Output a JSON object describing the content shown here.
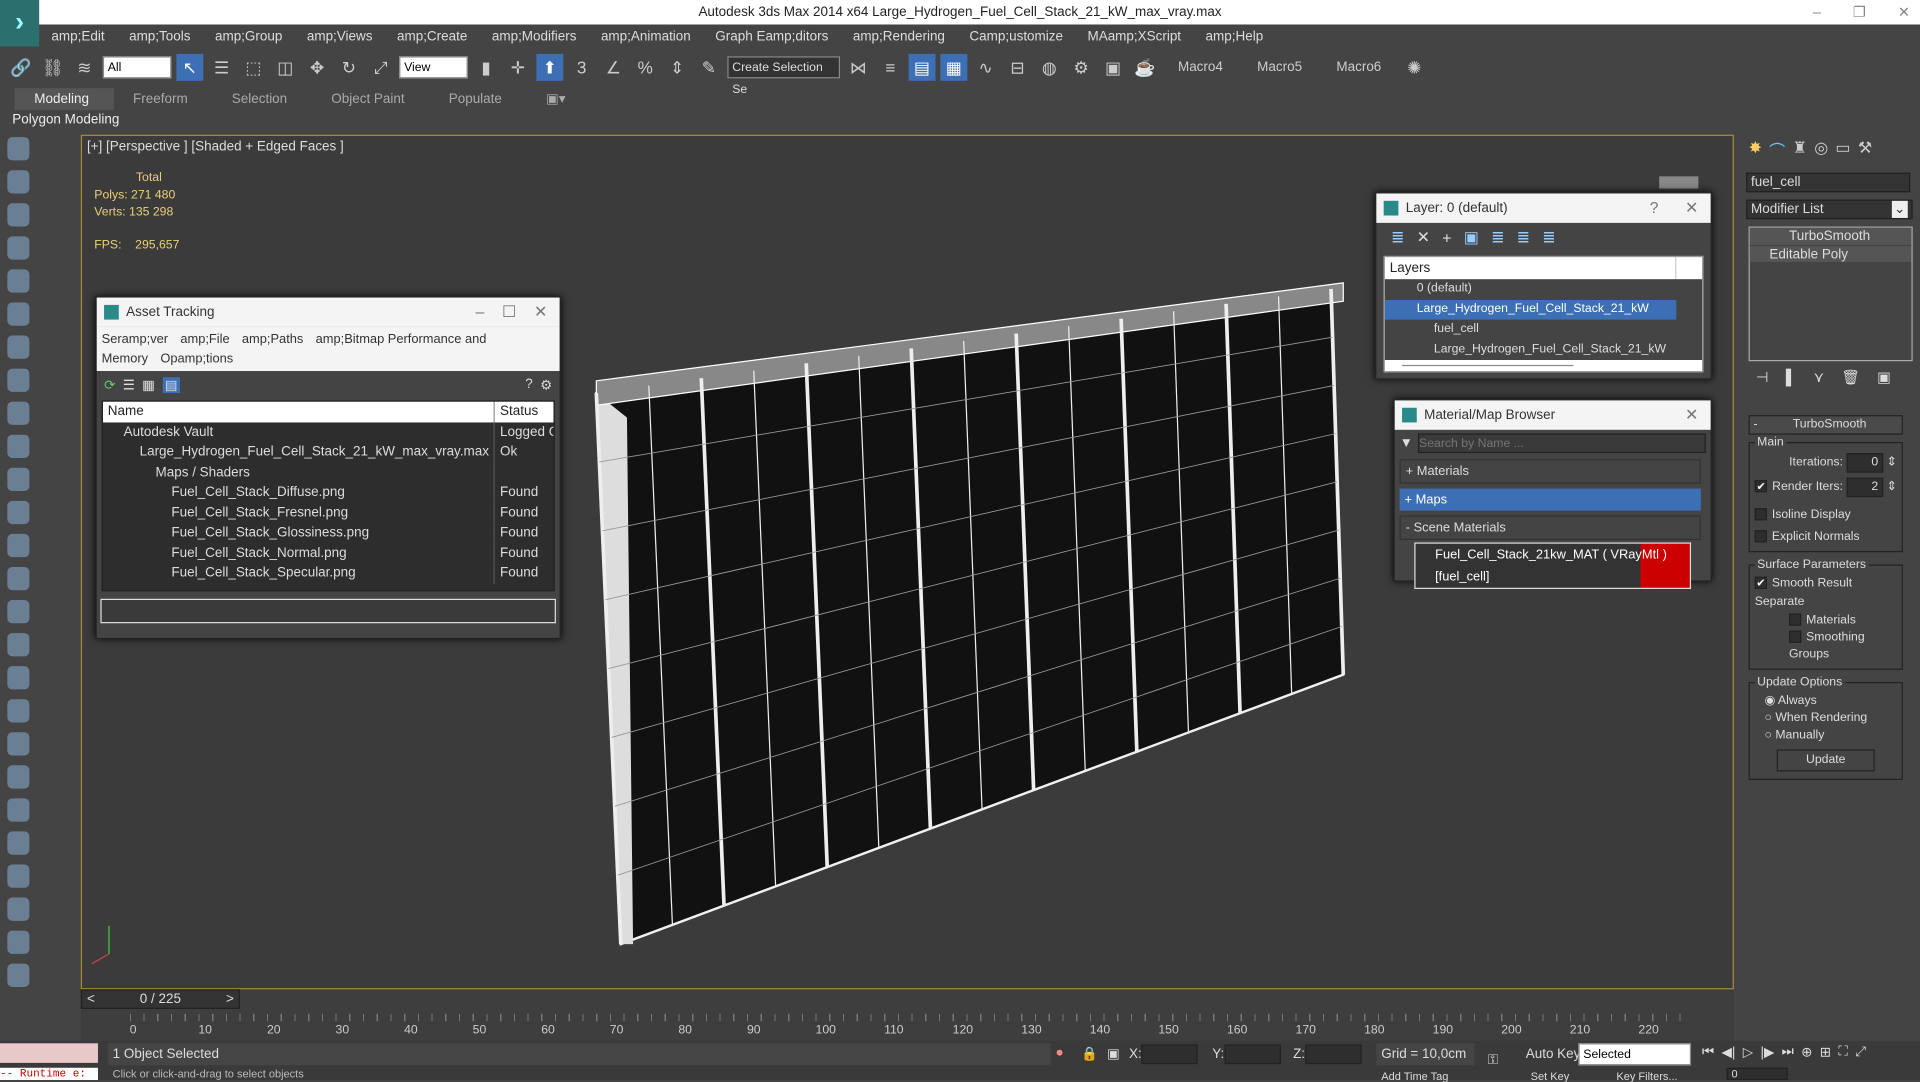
{
  "app": {
    "title": "Autodesk 3ds Max  2014 x64    Large_Hydrogen_Fuel_Cell_Stack_21_kW_max_vray.max",
    "window_controls": [
      "–",
      "❐",
      "✕"
    ]
  },
  "menu": [
    "amp;Edit",
    "amp;Tools",
    "amp;Group",
    "amp;Views",
    "amp;Create",
    "amp;Modifiers",
    "amp;Animation",
    "Graph Eamp;ditors",
    "amp;Rendering",
    "Camp;ustomize",
    "MAamp;XScript",
    "amp;Help"
  ],
  "toolbar": {
    "selection_filter": "All",
    "ref_coord": "View",
    "named_selection": "Create Selection Se",
    "macros": [
      "Macro4",
      "Macro5",
      "Macro6"
    ]
  },
  "ribbon": {
    "tabs": [
      "Modeling",
      "Freeform",
      "Selection",
      "Object Paint",
      "Populate"
    ],
    "active": "Modeling",
    "panel": "Polygon Modeling"
  },
  "viewport": {
    "label": "[+] [Perspective ] [Shaded + Edged Faces ]",
    "stats": {
      "total_label": "Total",
      "polys_label": "Polys:",
      "polys": "271 480",
      "verts_label": "Verts:",
      "verts": "135 298",
      "fps_label": "FPS:",
      "fps": "295,657"
    }
  },
  "asset_tracking": {
    "title": "Asset Tracking",
    "menu": [
      "Seramp;ver",
      "amp;File",
      "amp;Paths",
      "amp;Bitmap Performance and Memory",
      "Opamp;tions"
    ],
    "columns": [
      "Name",
      "Status"
    ],
    "rows": [
      {
        "name": "Autodesk Vault",
        "status": "Logged Ou",
        "indent": 1
      },
      {
        "name": "Large_Hydrogen_Fuel_Cell_Stack_21_kW_max_vray.max",
        "status": "Ok",
        "indent": 2
      },
      {
        "name": "Maps / Shaders",
        "status": "",
        "indent": 3
      },
      {
        "name": "Fuel_Cell_Stack_Diffuse.png",
        "status": "Found",
        "indent": 4
      },
      {
        "name": "Fuel_Cell_Stack_Fresnel.png",
        "status": "Found",
        "indent": 4
      },
      {
        "name": "Fuel_Cell_Stack_Glossiness.png",
        "status": "Found",
        "indent": 4
      },
      {
        "name": "Fuel_Cell_Stack_Normal.png",
        "status": "Found",
        "indent": 4
      },
      {
        "name": "Fuel_Cell_Stack_Specular.png",
        "status": "Found",
        "indent": 4
      }
    ]
  },
  "layer_window": {
    "title": "Layer: 0 (default)",
    "help": "?",
    "header": "Layers",
    "rows": [
      "0 (default)",
      "Large_Hydrogen_Fuel_Cell_Stack_21_kW",
      "fuel_cell",
      "Large_Hydrogen_Fuel_Cell_Stack_21_kW"
    ]
  },
  "material_browser": {
    "title": "Material/Map Browser",
    "search_placeholder": "Search by Name ...",
    "sections": [
      "+ Materials",
      "+ Maps",
      "- Scene Materials"
    ],
    "material": "Fuel_Cell_Stack_21kw_MAT ( VRayMtl ) [fuel_cell]"
  },
  "command_panel": {
    "object_name": "fuel_cell",
    "modifier_list": "Modifier List",
    "stack": [
      "TurboSmooth",
      "Editable Poly"
    ],
    "rollout": "TurboSmooth",
    "main": "Main",
    "iterations_label": "Iterations:",
    "iterations": "0",
    "render_iters_label": "Render Iters:",
    "render_iters": "2",
    "isoline": "Isoline Display",
    "explicit": "Explicit Normals",
    "surface": "Surface Parameters",
    "smooth_result": "Smooth Result",
    "separate": "Separate",
    "materials": "Materials",
    "smoothing_groups": "Smoothing Groups",
    "update_options": "Update Options",
    "always": "Always",
    "when_rendering": "When Rendering",
    "manually": "Manually",
    "update": "Update"
  },
  "timeline": {
    "frame": "0 / 225",
    "ticks": [
      "0",
      "10",
      "20",
      "30",
      "40",
      "50",
      "60",
      "70",
      "80",
      "90",
      "100",
      "110",
      "120",
      "130",
      "140",
      "150",
      "160",
      "170",
      "180",
      "190",
      "200",
      "210",
      "220"
    ]
  },
  "status": {
    "selected": "1 Object Selected",
    "prompt": "Click or click-and-drag to select objects",
    "runtime": "-- Runtime e:",
    "x": "X:",
    "y": "Y:",
    "z": "Z:",
    "grid": "Grid = 10,0cm",
    "auto_key": "Auto Key",
    "key_mode": "Selected",
    "set_key": "Set Key",
    "key_filters": "Key Filters...",
    "add_time_tag": "Add Time Tag",
    "frame": "0"
  }
}
